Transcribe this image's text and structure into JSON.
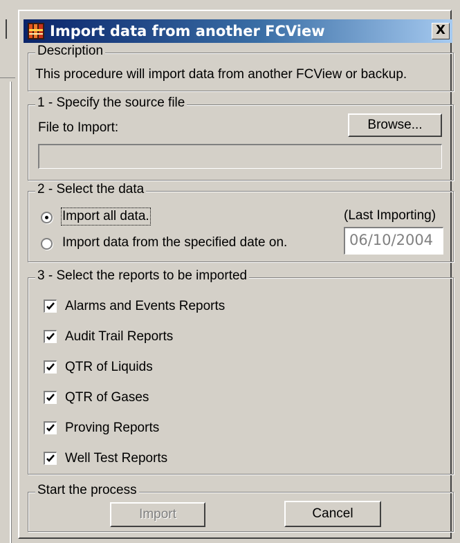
{
  "window": {
    "title": "Import data from another FCView",
    "close_glyph": "X",
    "title_icon": "fcview-app-icon"
  },
  "description": {
    "legend": "Description",
    "text": "This procedure will import data from another FCView or backup."
  },
  "source": {
    "legend": "1 - Specify the source file",
    "file_label": "File to Import:",
    "browse_label": "Browse...",
    "file_value": ""
  },
  "select_data": {
    "legend": "2 - Select the data",
    "options": [
      {
        "label": "Import all data.",
        "selected": true
      },
      {
        "label": "Import data from the specified date on.",
        "selected": false
      }
    ],
    "last_importing_label": "(Last Importing)",
    "date_value": "06/10/2004"
  },
  "reports": {
    "legend": "3 - Select the reports to be imported",
    "items": [
      {
        "label": "Alarms and Events Reports",
        "checked": true
      },
      {
        "label": "Audit Trail Reports",
        "checked": true
      },
      {
        "label": "QTR of Liquids",
        "checked": true
      },
      {
        "label": "QTR of Gases",
        "checked": true
      },
      {
        "label": "Proving Reports",
        "checked": true
      },
      {
        "label": "Well Test Reports",
        "checked": true
      }
    ]
  },
  "process": {
    "legend": "Start the process",
    "import_label": "Import",
    "import_enabled": false,
    "cancel_label": "Cancel"
  },
  "colors": {
    "face": "#d4d0c8",
    "title_start": "#0a246a",
    "title_end": "#a6caf0",
    "disabled_text": "#808080"
  }
}
